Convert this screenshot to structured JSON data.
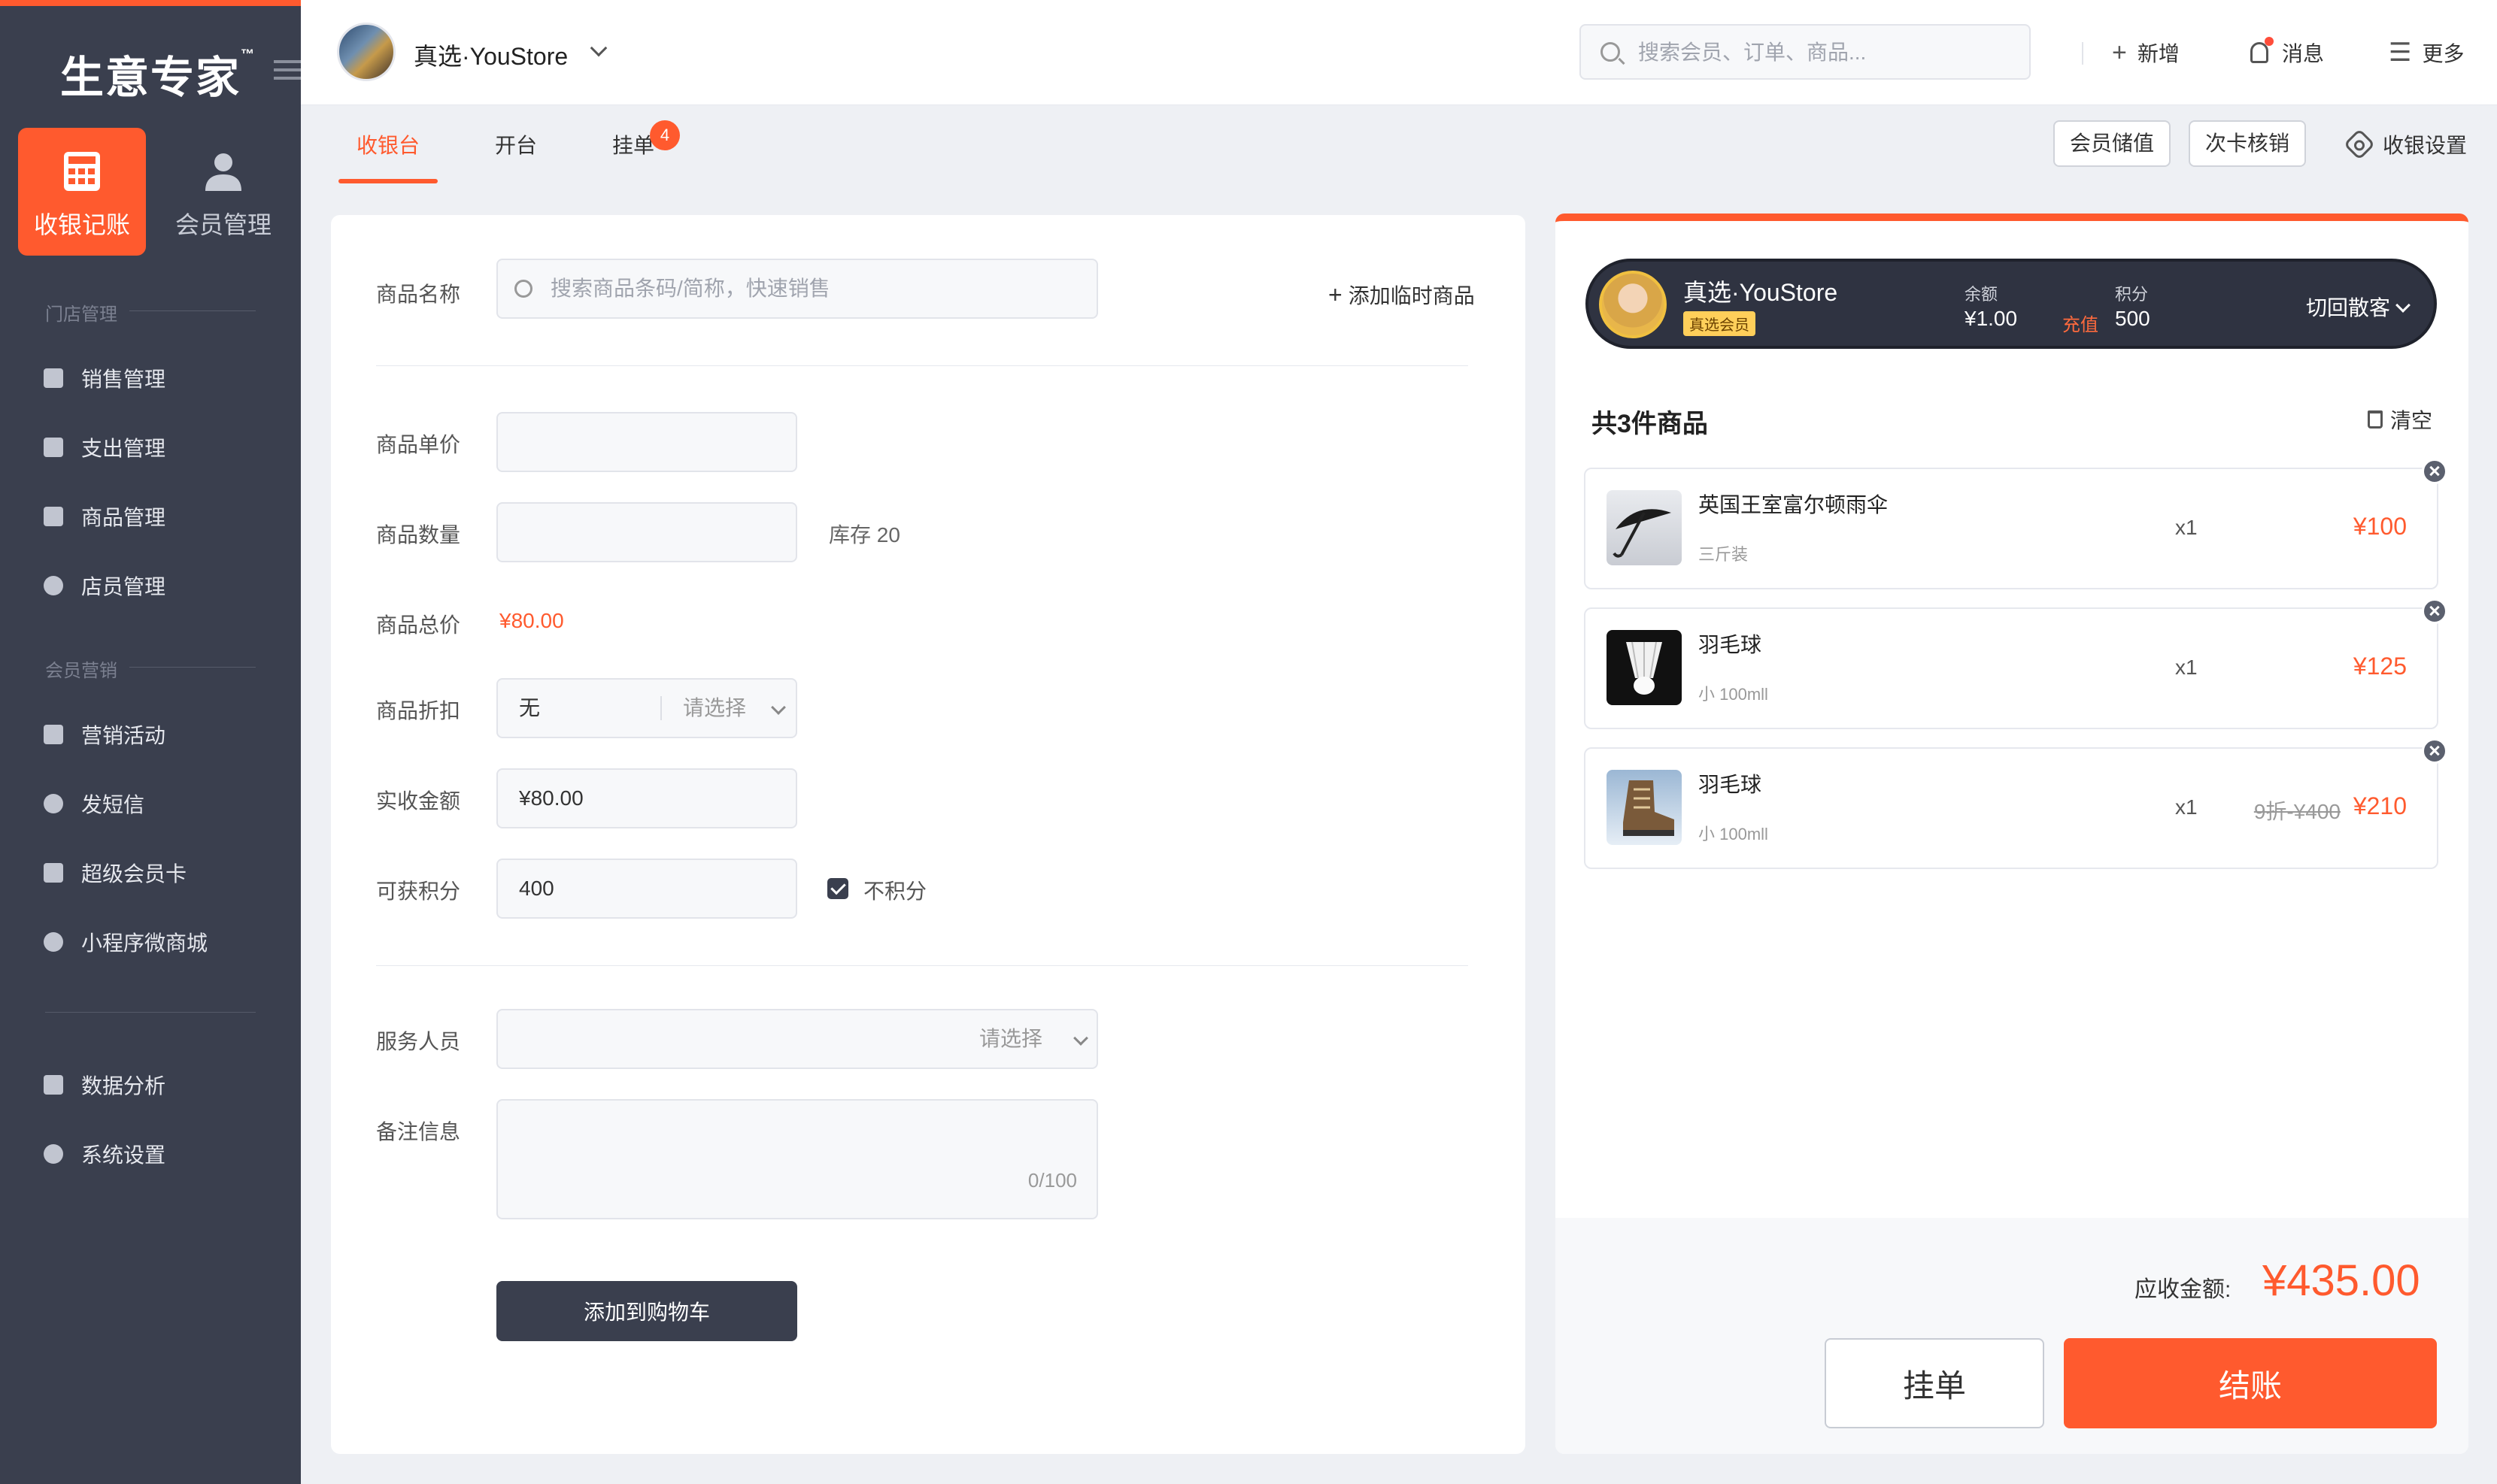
{
  "brand": {
    "logo": "生意专家",
    "tm": "™"
  },
  "modules": [
    {
      "label": "收银记账",
      "icon": "calculator-icon"
    },
    {
      "label": "会员管理",
      "icon": "user-icon"
    }
  ],
  "sidebar": {
    "sections": [
      {
        "title": "门店管理",
        "items": [
          {
            "label": "销售管理",
            "icon": "receipt-icon"
          },
          {
            "label": "支出管理",
            "icon": "expense-icon"
          },
          {
            "label": "商品管理",
            "icon": "box-icon"
          },
          {
            "label": "店员管理",
            "icon": "staff-icon"
          }
        ]
      },
      {
        "title": "会员营销",
        "items": [
          {
            "label": "营销活动",
            "icon": "tag-icon"
          },
          {
            "label": "发短信",
            "icon": "message-icon"
          },
          {
            "label": "超级会员卡",
            "icon": "vip-card-icon"
          },
          {
            "label": "小程序微商城",
            "icon": "miniapp-icon"
          }
        ]
      }
    ],
    "bottom_items": [
      {
        "label": "数据分析",
        "icon": "bar-chart-icon"
      },
      {
        "label": "系统设置",
        "icon": "settings-icon"
      }
    ]
  },
  "header": {
    "store_name": "真选·YouStore",
    "search_placeholder": "搜索会员、订单、商品...",
    "actions": {
      "add": "新增",
      "messages": "消息",
      "more": "更多"
    }
  },
  "tabs": [
    {
      "label": "收银台",
      "active": true
    },
    {
      "label": "开台"
    },
    {
      "label": "挂单",
      "badge": "4"
    }
  ],
  "tab_actions": {
    "member_recharge": "会员储值",
    "card_redeem": "次卡核销",
    "settings": "收银设置"
  },
  "form": {
    "product_name_label": "商品名称",
    "product_search_placeholder": "搜索商品条码/简称，快速销售",
    "add_temp_product": "添加临时商品",
    "unit_price_label": "商品单价",
    "unit_price_value": "",
    "quantity_label": "商品数量",
    "quantity_value": "",
    "stock_text": "库存 20",
    "total_label": "商品总价",
    "total_value": "¥80.00",
    "discount_label": "商品折扣",
    "discount_value": "无",
    "discount_placeholder": "请选择",
    "received_label": "实收金额",
    "received_value": "¥80.00",
    "points_label": "可获积分",
    "points_value": "400",
    "no_points_label": "不积分",
    "no_points_checked": true,
    "staff_label": "服务人员",
    "staff_placeholder": "请选择",
    "remark_label": "备注信息",
    "remark_counter": "0/100",
    "add_to_cart": "添加到购物车"
  },
  "member": {
    "name": "真选·YouStore",
    "badge": "真选会员",
    "balance_label": "余额",
    "balance_value": "¥1.00",
    "recharge": "充值",
    "points_label": "积分",
    "points_value": "500",
    "switch_label": "切回散客"
  },
  "cart": {
    "title": "共3件商品",
    "clear": "清空",
    "items": [
      {
        "name": "英国王室富尔顿雨伞",
        "spec": "三斤装",
        "qty": "x1",
        "price": "¥100",
        "orig": "",
        "thumb": "umbrella"
      },
      {
        "name": "羽毛球",
        "spec": "小  100mll",
        "qty": "x1",
        "price": "¥125",
        "orig": "",
        "thumb": "shuttlecock"
      },
      {
        "name": "羽毛球",
        "spec": "小  100mll",
        "qty": "x1",
        "price": "¥210",
        "orig": "9折-¥400",
        "thumb": "boot"
      }
    ],
    "total_label": "应收金额:",
    "total_value": "¥435.00",
    "hold_button": "挂单",
    "checkout_button": "结账"
  },
  "colors": {
    "accent": "#ff5a2e",
    "sidebar": "#3a3f4e"
  }
}
